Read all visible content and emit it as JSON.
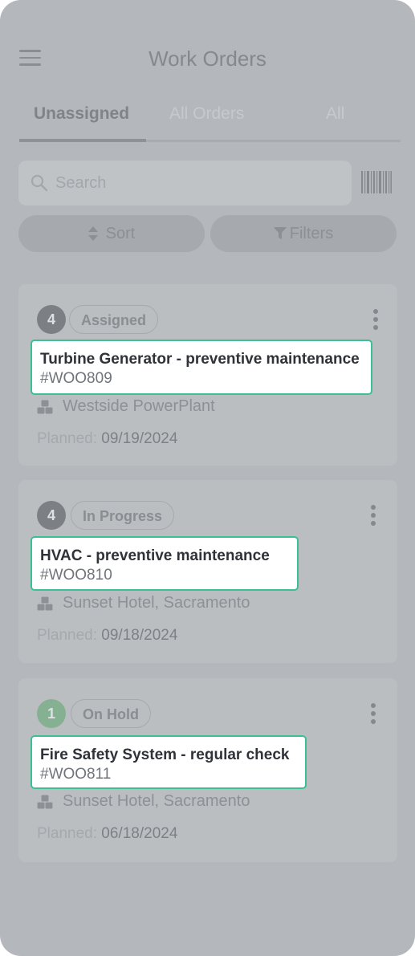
{
  "header": {
    "title": "Work Orders"
  },
  "tabs": [
    {
      "label": "Unassigned",
      "active": true
    },
    {
      "label": "All Orders",
      "active": false
    },
    {
      "label": "All",
      "active": false
    }
  ],
  "search": {
    "placeholder": "Search"
  },
  "toolbar": {
    "sort_label": "Sort",
    "filters_label": "Filters"
  },
  "icons": {
    "menu": "hamburger-icon",
    "search": "search-icon",
    "barcode": "barcode-icon",
    "sort": "sort-icon",
    "filter": "filter-icon",
    "more": "kebab-icon",
    "location": "location-cubes-icon"
  },
  "colors": {
    "highlight_border": "#3bbf94",
    "badge_green": "#85b192",
    "badge_gray": "#7c7f83"
  },
  "orders": [
    {
      "count": "4",
      "status": "Assigned",
      "name": "Turbine Generator - preventive maintenance",
      "id": "#WOO809",
      "location": "Westside PowerPlant",
      "planned_label": "Planned:",
      "planned_date": "09/19/2024"
    },
    {
      "count": "4",
      "status": "In Progress",
      "name": "HVAC - preventive maintenance",
      "id": "#WOO810",
      "location": "Sunset Hotel, Sacramento",
      "planned_label": "Planned:",
      "planned_date": "09/18/2024"
    },
    {
      "count": "1",
      "status": "On Hold",
      "name": "Fire Safety System - regular check",
      "id": "#WOO811",
      "location": "Sunset Hotel, Sacramento",
      "planned_label": "Planned:",
      "planned_date": "06/18/2024"
    }
  ]
}
